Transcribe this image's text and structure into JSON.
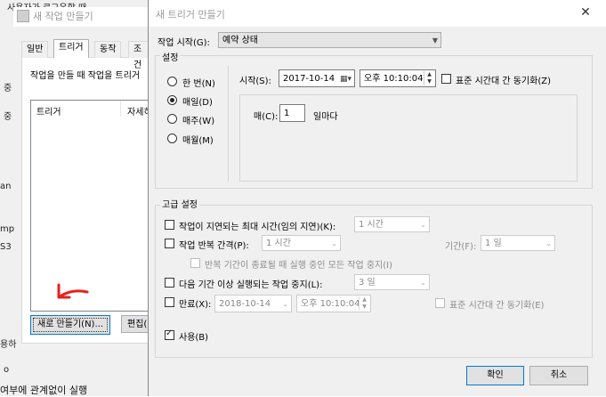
{
  "back_window": {
    "title": "새 작업 만들기",
    "tabs": [
      "일반",
      "트리거",
      "동작",
      "조건"
    ],
    "hint": "작업을 만들 때 작업을 트리거",
    "list_columns": [
      "트리거",
      "자세히"
    ],
    "new_button": "새로 만들기(N)...",
    "edit_button": "편집(",
    "bg_fragments": [
      "사용자가 로그온할 때",
      "중",
      "중",
      "an",
      "mp",
      "S3",
      "용하",
      "o",
      "여부에 관계없이 실행"
    ]
  },
  "dialog": {
    "title": "새 트리거 만들기",
    "start_task_label": "작업 시작(G):",
    "start_task_value": "예약 상태",
    "settings_legend": "설정",
    "radios": [
      {
        "label": "한 번(N)",
        "checked": false
      },
      {
        "label": "매일(D)",
        "checked": true
      },
      {
        "label": "매주(W)",
        "checked": false
      },
      {
        "label": "매월(M)",
        "checked": false
      }
    ],
    "start_label": "시작(S):",
    "start_date": "2017-10-14",
    "start_time": "오후 10:10:04",
    "sync_tz_label": "표준 시간대 간 동기화(Z)",
    "every_label": "매(C):",
    "every_value": "1",
    "every_unit": "일마다",
    "advanced_legend": "고급 설정",
    "delay_label": "작업이 지연되는 최대 시간(임의 지연)(K):",
    "delay_value": "1 시간",
    "repeat_label": "작업 반복 간격(P):",
    "repeat_value": "1 시간",
    "duration_label": "기간(F):",
    "duration_value": "1 일",
    "stop_all_label": "반복 기간이 종료될 때 실행 중인 모든 작업 중지(I)",
    "stop_longer_label": "다음 기간 이상 실행되는 작업 중지(L):",
    "stop_longer_value": "3 일",
    "expire_label": "만료(X):",
    "expire_date": "2018-10-14",
    "expire_time": "오후 10:10:04",
    "expire_sync_label": "표준 시간대 간 동기화(E)",
    "enabled_label": "사용(B)",
    "ok_button": "확인",
    "cancel_button": "취소"
  },
  "colors": {
    "annotation_arrow": "#e8201e"
  }
}
